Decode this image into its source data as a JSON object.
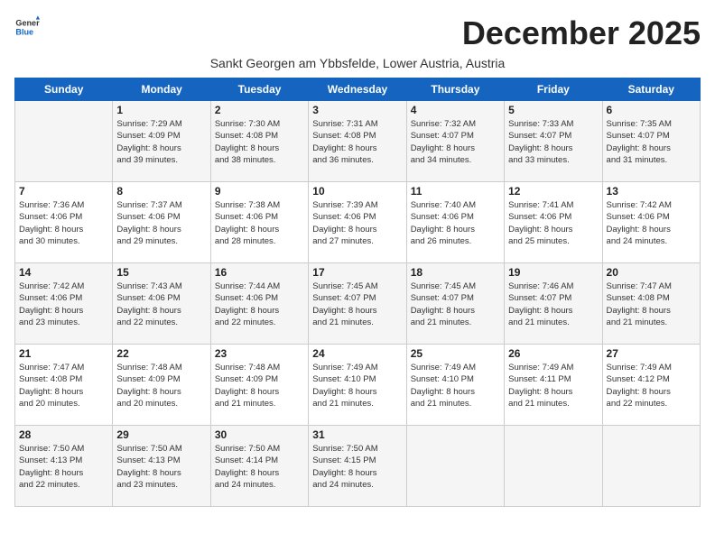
{
  "logo": {
    "line1": "General",
    "line2": "Blue"
  },
  "title": "December 2025",
  "subtitle": "Sankt Georgen am Ybbsfelde, Lower Austria, Austria",
  "days_of_week": [
    "Sunday",
    "Monday",
    "Tuesday",
    "Wednesday",
    "Thursday",
    "Friday",
    "Saturday"
  ],
  "weeks": [
    [
      {
        "day": "",
        "info": ""
      },
      {
        "day": "1",
        "info": "Sunrise: 7:29 AM\nSunset: 4:09 PM\nDaylight: 8 hours\nand 39 minutes."
      },
      {
        "day": "2",
        "info": "Sunrise: 7:30 AM\nSunset: 4:08 PM\nDaylight: 8 hours\nand 38 minutes."
      },
      {
        "day": "3",
        "info": "Sunrise: 7:31 AM\nSunset: 4:08 PM\nDaylight: 8 hours\nand 36 minutes."
      },
      {
        "day": "4",
        "info": "Sunrise: 7:32 AM\nSunset: 4:07 PM\nDaylight: 8 hours\nand 34 minutes."
      },
      {
        "day": "5",
        "info": "Sunrise: 7:33 AM\nSunset: 4:07 PM\nDaylight: 8 hours\nand 33 minutes."
      },
      {
        "day": "6",
        "info": "Sunrise: 7:35 AM\nSunset: 4:07 PM\nDaylight: 8 hours\nand 31 minutes."
      }
    ],
    [
      {
        "day": "7",
        "info": "Sunrise: 7:36 AM\nSunset: 4:06 PM\nDaylight: 8 hours\nand 30 minutes."
      },
      {
        "day": "8",
        "info": "Sunrise: 7:37 AM\nSunset: 4:06 PM\nDaylight: 8 hours\nand 29 minutes."
      },
      {
        "day": "9",
        "info": "Sunrise: 7:38 AM\nSunset: 4:06 PM\nDaylight: 8 hours\nand 28 minutes."
      },
      {
        "day": "10",
        "info": "Sunrise: 7:39 AM\nSunset: 4:06 PM\nDaylight: 8 hours\nand 27 minutes."
      },
      {
        "day": "11",
        "info": "Sunrise: 7:40 AM\nSunset: 4:06 PM\nDaylight: 8 hours\nand 26 minutes."
      },
      {
        "day": "12",
        "info": "Sunrise: 7:41 AM\nSunset: 4:06 PM\nDaylight: 8 hours\nand 25 minutes."
      },
      {
        "day": "13",
        "info": "Sunrise: 7:42 AM\nSunset: 4:06 PM\nDaylight: 8 hours\nand 24 minutes."
      }
    ],
    [
      {
        "day": "14",
        "info": "Sunrise: 7:42 AM\nSunset: 4:06 PM\nDaylight: 8 hours\nand 23 minutes."
      },
      {
        "day": "15",
        "info": "Sunrise: 7:43 AM\nSunset: 4:06 PM\nDaylight: 8 hours\nand 22 minutes."
      },
      {
        "day": "16",
        "info": "Sunrise: 7:44 AM\nSunset: 4:06 PM\nDaylight: 8 hours\nand 22 minutes."
      },
      {
        "day": "17",
        "info": "Sunrise: 7:45 AM\nSunset: 4:07 PM\nDaylight: 8 hours\nand 21 minutes."
      },
      {
        "day": "18",
        "info": "Sunrise: 7:45 AM\nSunset: 4:07 PM\nDaylight: 8 hours\nand 21 minutes."
      },
      {
        "day": "19",
        "info": "Sunrise: 7:46 AM\nSunset: 4:07 PM\nDaylight: 8 hours\nand 21 minutes."
      },
      {
        "day": "20",
        "info": "Sunrise: 7:47 AM\nSunset: 4:08 PM\nDaylight: 8 hours\nand 21 minutes."
      }
    ],
    [
      {
        "day": "21",
        "info": "Sunrise: 7:47 AM\nSunset: 4:08 PM\nDaylight: 8 hours\nand 20 minutes."
      },
      {
        "day": "22",
        "info": "Sunrise: 7:48 AM\nSunset: 4:09 PM\nDaylight: 8 hours\nand 20 minutes."
      },
      {
        "day": "23",
        "info": "Sunrise: 7:48 AM\nSunset: 4:09 PM\nDaylight: 8 hours\nand 21 minutes."
      },
      {
        "day": "24",
        "info": "Sunrise: 7:49 AM\nSunset: 4:10 PM\nDaylight: 8 hours\nand 21 minutes."
      },
      {
        "day": "25",
        "info": "Sunrise: 7:49 AM\nSunset: 4:10 PM\nDaylight: 8 hours\nand 21 minutes."
      },
      {
        "day": "26",
        "info": "Sunrise: 7:49 AM\nSunset: 4:11 PM\nDaylight: 8 hours\nand 21 minutes."
      },
      {
        "day": "27",
        "info": "Sunrise: 7:49 AM\nSunset: 4:12 PM\nDaylight: 8 hours\nand 22 minutes."
      }
    ],
    [
      {
        "day": "28",
        "info": "Sunrise: 7:50 AM\nSunset: 4:13 PM\nDaylight: 8 hours\nand 22 minutes."
      },
      {
        "day": "29",
        "info": "Sunrise: 7:50 AM\nSunset: 4:13 PM\nDaylight: 8 hours\nand 23 minutes."
      },
      {
        "day": "30",
        "info": "Sunrise: 7:50 AM\nSunset: 4:14 PM\nDaylight: 8 hours\nand 24 minutes."
      },
      {
        "day": "31",
        "info": "Sunrise: 7:50 AM\nSunset: 4:15 PM\nDaylight: 8 hours\nand 24 minutes."
      },
      {
        "day": "",
        "info": ""
      },
      {
        "day": "",
        "info": ""
      },
      {
        "day": "",
        "info": ""
      }
    ]
  ]
}
